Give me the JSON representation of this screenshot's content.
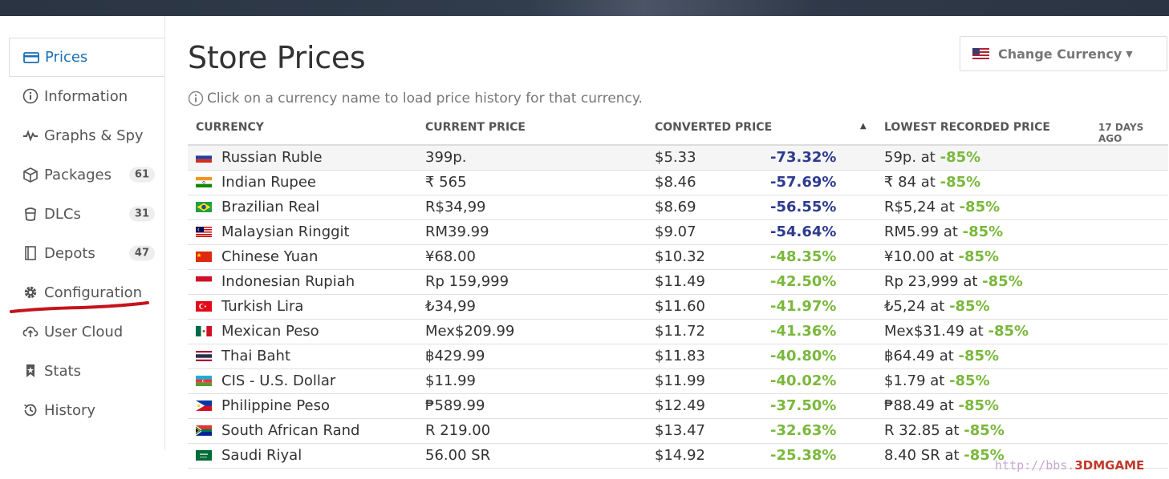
{
  "sidebar": {
    "items": [
      {
        "label": "Prices",
        "icon": "credit-card-icon",
        "active": true
      },
      {
        "label": "Information",
        "icon": "info-circle-icon"
      },
      {
        "label": "Graphs & Spy",
        "icon": "pulse-icon"
      },
      {
        "label": "Packages",
        "icon": "package-icon",
        "badge": "61"
      },
      {
        "label": "DLCs",
        "icon": "dlc-bucket-icon",
        "badge": "31"
      },
      {
        "label": "Depots",
        "icon": "book-icon",
        "badge": "47"
      },
      {
        "label": "Configuration",
        "icon": "gear-icon"
      },
      {
        "label": "User Cloud",
        "icon": "cloud-upload-icon"
      },
      {
        "label": "Stats",
        "icon": "bookmark-icon"
      },
      {
        "label": "History",
        "icon": "history-icon"
      }
    ]
  },
  "header": {
    "title": "Store Prices",
    "currency_button": "Change Currency",
    "hint": "Click on a currency name to load price history for that currency."
  },
  "table": {
    "columns": {
      "currency": "CURRENCY",
      "current_price": "CURRENT PRICE",
      "converted_price": "CONVERTED PRICE",
      "lowest_price": "LOWEST RECORDED PRICE",
      "age": "17 DAYS AGO"
    },
    "rows": [
      {
        "flag": "ru",
        "currency": "Russian Ruble",
        "current": "399p.",
        "converted": "$5.33",
        "pct": "-73.32%",
        "pct_color": "blue",
        "low": "59p. at ",
        "low_pct": "-85%"
      },
      {
        "flag": "in",
        "currency": "Indian Rupee",
        "current": "₹ 565",
        "converted": "$8.46",
        "pct": "-57.69%",
        "pct_color": "blue",
        "low": "₹ 84 at ",
        "low_pct": "-85%"
      },
      {
        "flag": "br",
        "currency": "Brazilian Real",
        "current": "R$34,99",
        "converted": "$8.69",
        "pct": "-56.55%",
        "pct_color": "blue",
        "low": "R$5,24 at ",
        "low_pct": "-85%"
      },
      {
        "flag": "my",
        "currency": "Malaysian Ringgit",
        "current": "RM39.99",
        "converted": "$9.07",
        "pct": "-54.64%",
        "pct_color": "blue",
        "low": "RM5.99 at ",
        "low_pct": "-85%"
      },
      {
        "flag": "cn",
        "currency": "Chinese Yuan",
        "current": "¥68.00",
        "converted": "$10.32",
        "pct": "-48.35%",
        "pct_color": "green",
        "low": "¥10.00 at ",
        "low_pct": "-85%"
      },
      {
        "flag": "id",
        "currency": "Indonesian Rupiah",
        "current": "Rp 159,999",
        "converted": "$11.49",
        "pct": "-42.50%",
        "pct_color": "green",
        "low": "Rp 23,999 at ",
        "low_pct": "-85%"
      },
      {
        "flag": "tr",
        "currency": "Turkish Lira",
        "current": "₺34,99",
        "converted": "$11.60",
        "pct": "-41.97%",
        "pct_color": "green",
        "low": "₺5,24 at ",
        "low_pct": "-85%"
      },
      {
        "flag": "mx",
        "currency": "Mexican Peso",
        "current": "Mex$209.99",
        "converted": "$11.72",
        "pct": "-41.36%",
        "pct_color": "green",
        "low": "Mex$31.49 at ",
        "low_pct": "-85%"
      },
      {
        "flag": "th",
        "currency": "Thai Baht",
        "current": "฿429.99",
        "converted": "$11.83",
        "pct": "-40.80%",
        "pct_color": "green",
        "low": "฿64.49 at ",
        "low_pct": "-85%"
      },
      {
        "flag": "az",
        "currency": "CIS - U.S. Dollar",
        "current": "$11.99",
        "converted": "$11.99",
        "pct": "-40.02%",
        "pct_color": "green",
        "low": "$1.79 at ",
        "low_pct": "-85%"
      },
      {
        "flag": "ph",
        "currency": "Philippine Peso",
        "current": "₱589.99",
        "converted": "$12.49",
        "pct": "-37.50%",
        "pct_color": "green",
        "low": "₱88.49 at ",
        "low_pct": "-85%"
      },
      {
        "flag": "za",
        "currency": "South African Rand",
        "current": "R 219.00",
        "converted": "$13.47",
        "pct": "-32.63%",
        "pct_color": "green",
        "low": "R 32.85 at ",
        "low_pct": "-85%"
      },
      {
        "flag": "sa",
        "currency": "Saudi Riyal",
        "current": "56.00 SR",
        "converted": "$14.92",
        "pct": "-25.38%",
        "pct_color": "green",
        "low": "8.40 SR at ",
        "low_pct": "-85%"
      }
    ]
  },
  "watermark": {
    "text": "http://bbs.",
    "brand": "3DMGAME"
  },
  "colors": {
    "accent": "#1a6fb4",
    "pct_blue": "#2e3b8f",
    "pct_green": "#7ab83c",
    "annotation_red": "#c4141b"
  }
}
